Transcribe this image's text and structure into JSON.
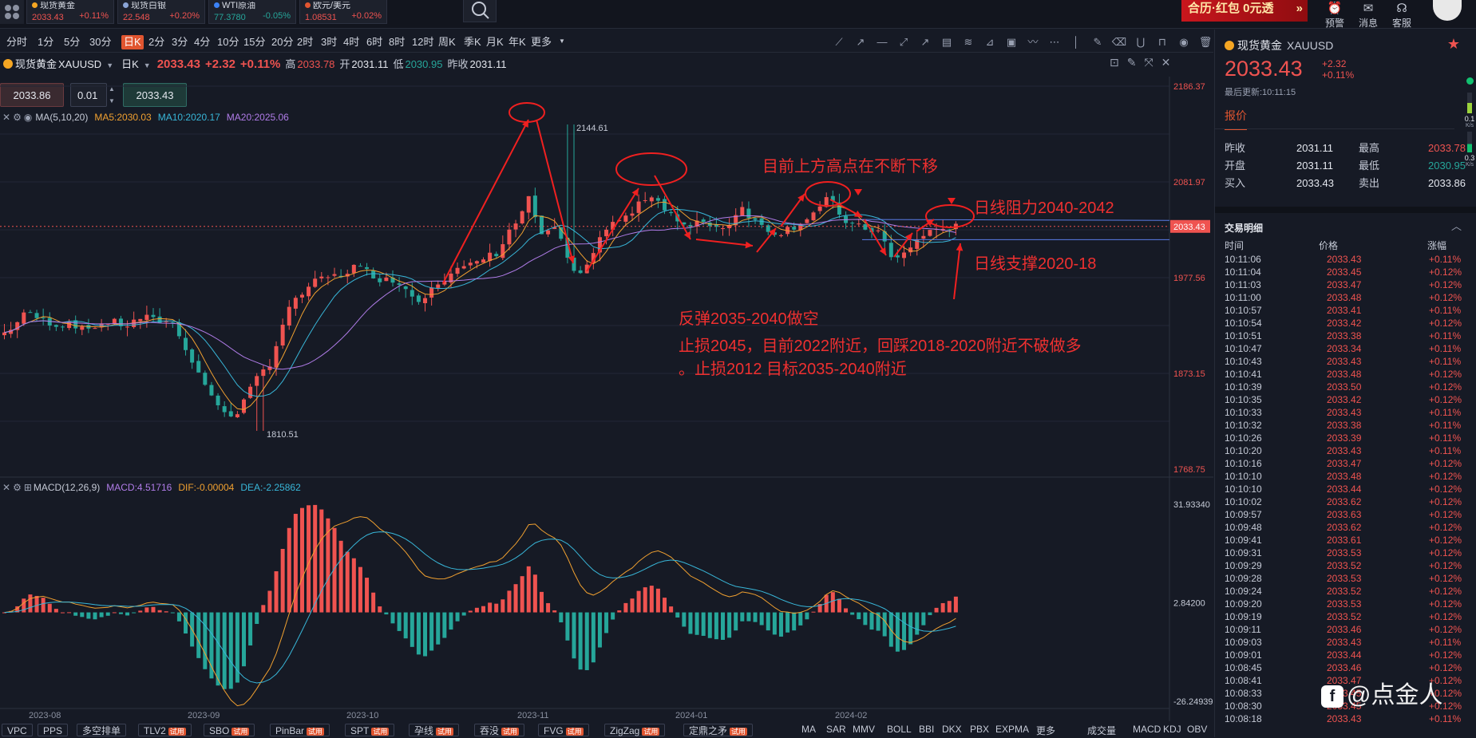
{
  "topbar": {
    "quotes": [
      {
        "name": "现货黄金",
        "price": "2033.43",
        "change": "+0.11%",
        "dir": "up",
        "dot": "#f5a623"
      },
      {
        "name": "现货白银",
        "price": "22.548",
        "change": "+0.20%",
        "dir": "up",
        "dot": "#8aa4d6"
      },
      {
        "name": "WTI原油",
        "price": "77.3780",
        "change": "-0.05%",
        "dir": "dn",
        "dot": "#3b82f6"
      },
      {
        "name": "欧元/美元",
        "price": "1.08531",
        "change": "+0.02%",
        "dir": "up",
        "dot": "#e05530"
      }
    ],
    "promo": "合历·红包 0元透",
    "icons": [
      {
        "label": "预警",
        "icon": "alarm-icon"
      },
      {
        "label": "消息",
        "icon": "message-icon"
      },
      {
        "label": "客服",
        "icon": "headset-icon"
      }
    ]
  },
  "periods": [
    "分时",
    "1分",
    "5分",
    "30分",
    "日K",
    "2分",
    "3分",
    "4分",
    "10分",
    "15分",
    "20分",
    "2时",
    "3时",
    "4时",
    "6时",
    "8时",
    "12时",
    "周K",
    "季K",
    "月K",
    "年K",
    "更多"
  ],
  "active_period": "日K",
  "symbol": {
    "name": "现货黄金",
    "code": "XAUUSD",
    "period": "日K",
    "price": "2033.43",
    "chg": "+2.32",
    "pct": "+0.11%",
    "high_label": "高",
    "high": "2033.78",
    "open_label": "开",
    "open": "2031.11",
    "low_label": "低",
    "low": "2030.95",
    "prev_label": "昨收",
    "prev": "2031.11"
  },
  "order": {
    "sell": "2033.86",
    "qty": "0.01",
    "buy": "2033.43"
  },
  "ma_legend": {
    "name": "MA(5,10,20)",
    "ma5": "MA5:2030.03",
    "ma10": "MA10:2020.17",
    "ma20": "MA20:2025.06"
  },
  "macd_legend": {
    "name": "MACD(12,26,9)",
    "macd": "MACD:4.51716",
    "dif": "DIF:-0.00004",
    "dea": "DEA:-2.25862"
  },
  "price_axis": [
    "2186.37",
    "2081.97",
    "1977.56",
    "1873.15",
    "1768.75"
  ],
  "macd_axis": [
    "31.93340",
    "2.84200",
    "-26.24939"
  ],
  "date_axis": [
    "2023-08",
    "2023-09",
    "2023-10",
    "2023-11",
    "2024-01",
    "2024-02"
  ],
  "last_price_tag": "2033.43",
  "extremes": {
    "high": "2144.61",
    "low": "1810.51"
  },
  "annotations": {
    "a1": "目前上方高点在不断下移",
    "a2": "日线阻力2040-2042",
    "a3": "日线支撑2020-18",
    "a4": "反弹2035-2040做空",
    "a5": "止损2045，目前2022附近，回踩2018-2020附近不破做多",
    "a6": "。止损2012  目标2035-2040附近"
  },
  "bottom": {
    "tags": [
      {
        "t": "VPC",
        "trial": ""
      },
      {
        "t": "PPS",
        "trial": ""
      },
      {
        "t": "多空排单",
        "trial": ""
      },
      {
        "t": "TLV2",
        "trial": "试用"
      },
      {
        "t": "SBO",
        "trial": "试用"
      },
      {
        "t": "PinBar",
        "trial": "试用"
      },
      {
        "t": "SPT",
        "trial": "试用"
      },
      {
        "t": "孕线",
        "trial": "试用"
      },
      {
        "t": "吞没",
        "trial": "试用"
      },
      {
        "t": "FVG",
        "trial": "试用"
      },
      {
        "t": "ZigZag",
        "trial": "试用"
      },
      {
        "t": "定鼎之矛",
        "trial": "试用"
      }
    ],
    "inds": [
      "MA",
      "SAR",
      "MMV",
      "BOLL",
      "BBI",
      "DKX",
      "PBX",
      "EXPMA",
      "更多"
    ],
    "inds2": [
      "成交量",
      "MACD",
      "KDJ",
      "OBV"
    ]
  },
  "panel": {
    "name": "现货黄金",
    "code": "XAUUSD",
    "price": "2033.43",
    "chg": "+2.32",
    "pct": "+0.11%",
    "updated": "最后更新:10:11:15",
    "tab": "报价",
    "stats": [
      [
        "昨收",
        "2031.11",
        "最高",
        "2033.78"
      ],
      [
        "开盘",
        "2031.11",
        "最低",
        "2030.95"
      ],
      [
        "买入",
        "2033.43",
        "卖出",
        "2033.86"
      ]
    ],
    "trades_title": "交易明细",
    "trades_cols": [
      "时间",
      "价格",
      "涨幅"
    ],
    "trades": [
      [
        "10:11:06",
        "2033.43",
        "+0.11%"
      ],
      [
        "10:11:04",
        "2033.45",
        "+0.12%"
      ],
      [
        "10:11:03",
        "2033.47",
        "+0.12%"
      ],
      [
        "10:11:00",
        "2033.48",
        "+0.12%"
      ],
      [
        "10:10:57",
        "2033.41",
        "+0.11%"
      ],
      [
        "10:10:54",
        "2033.42",
        "+0.12%"
      ],
      [
        "10:10:51",
        "2033.38",
        "+0.11%"
      ],
      [
        "10:10:47",
        "2033.34",
        "+0.11%"
      ],
      [
        "10:10:43",
        "2033.43",
        "+0.11%"
      ],
      [
        "10:10:41",
        "2033.48",
        "+0.12%"
      ],
      [
        "10:10:39",
        "2033.50",
        "+0.12%"
      ],
      [
        "10:10:35",
        "2033.42",
        "+0.12%"
      ],
      [
        "10:10:33",
        "2033.43",
        "+0.11%"
      ],
      [
        "10:10:32",
        "2033.38",
        "+0.11%"
      ],
      [
        "10:10:26",
        "2033.39",
        "+0.11%"
      ],
      [
        "10:10:20",
        "2033.43",
        "+0.11%"
      ],
      [
        "10:10:16",
        "2033.47",
        "+0.12%"
      ],
      [
        "10:10:10",
        "2033.48",
        "+0.12%"
      ],
      [
        "10:10:10",
        "2033.44",
        "+0.12%"
      ],
      [
        "10:10:02",
        "2033.62",
        "+0.12%"
      ],
      [
        "10:09:57",
        "2033.63",
        "+0.12%"
      ],
      [
        "10:09:48",
        "2033.62",
        "+0.12%"
      ],
      [
        "10:09:41",
        "2033.61",
        "+0.12%"
      ],
      [
        "10:09:31",
        "2033.53",
        "+0.12%"
      ],
      [
        "10:09:29",
        "2033.52",
        "+0.12%"
      ],
      [
        "10:09:28",
        "2033.53",
        "+0.12%"
      ],
      [
        "10:09:24",
        "2033.52",
        "+0.12%"
      ],
      [
        "10:09:20",
        "2033.53",
        "+0.12%"
      ],
      [
        "10:09:19",
        "2033.52",
        "+0.12%"
      ],
      [
        "10:09:11",
        "2033.46",
        "+0.12%"
      ],
      [
        "10:09:03",
        "2033.43",
        "+0.11%"
      ],
      [
        "10:09:01",
        "2033.44",
        "+0.12%"
      ],
      [
        "10:08:45",
        "2033.46",
        "+0.12%"
      ],
      [
        "10:08:41",
        "2033.47",
        "+0.12%"
      ],
      [
        "10:08:33",
        "2033.45",
        "+0.12%"
      ],
      [
        "10:08:30",
        "2033.45",
        "+0.12%"
      ],
      [
        "10:08:18",
        "2033.43",
        "+0.11%"
      ]
    ],
    "side": {
      "v1": "0.1",
      "v1u": "K/s",
      "v2": "0.3",
      "v2u": "K/s"
    }
  },
  "watermark": "@点金人"
}
